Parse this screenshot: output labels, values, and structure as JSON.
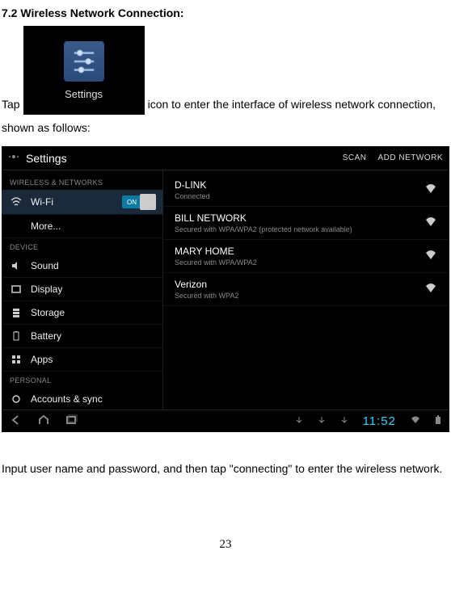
{
  "heading": "7.2 Wireless Network Connection:",
  "para1_pre": "Tap",
  "para1_post": "icon to enter the interface of wireless network connection,",
  "para1_line2": "shown as follows:",
  "settings_icon_label": "Settings",
  "screenshot": {
    "top": {
      "title": "Settings",
      "scan": "SCAN",
      "add": "ADD NETWORK"
    },
    "left": {
      "section1": "WIRELESS & NETWORKS",
      "wifi": "Wi-Fi",
      "wifi_toggle": "ON",
      "more": "More...",
      "section2": "DEVICE",
      "sound": "Sound",
      "display": "Display",
      "storage": "Storage",
      "battery": "Battery",
      "apps": "Apps",
      "section3": "PERSONAL",
      "accounts": "Accounts & sync"
    },
    "networks": [
      {
        "name": "D-LINK",
        "sub": "Connected"
      },
      {
        "name": "BILL NETWORK",
        "sub": "Secured with WPA/WPA2 (protected network available)"
      },
      {
        "name": "MARY HOME",
        "sub": "Secured with WPA/WPA2"
      },
      {
        "name": "Verizon",
        "sub": "Secured with WPA2"
      }
    ],
    "clock": "11:52"
  },
  "body_text": "Input user name and password, and then tap \"connecting\" to enter the wireless network.",
  "page_number": "23"
}
